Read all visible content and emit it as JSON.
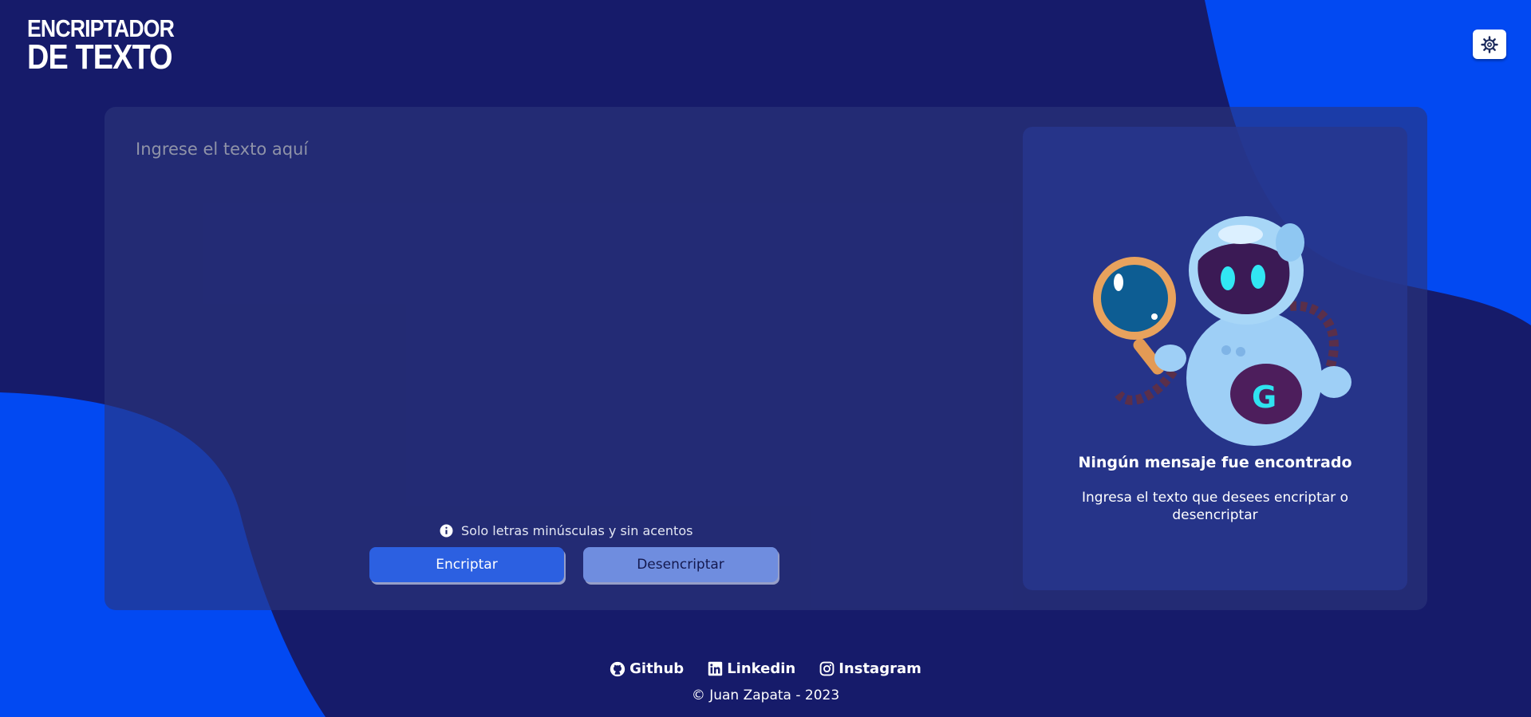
{
  "header": {
    "logo_line1": "ENCRIPTADOR",
    "logo_line2": "DE TEXTO",
    "theme_icon": "gear-icon"
  },
  "editor": {
    "placeholder": "Ingrese el texto aquí",
    "value": "",
    "hint": "Solo letras minúsculas y sin acentos",
    "hint_icon": "info-icon"
  },
  "buttons": {
    "encrypt_label": "Encriptar",
    "decrypt_label": "Desencriptar"
  },
  "result": {
    "illustration": "robot-magnifier-illustration",
    "title": "Ningún mensaje fue encontrado",
    "subtitle": "Ingresa el texto que desees encriptar o desencriptar"
  },
  "footer": {
    "links": [
      {
        "label": "Github",
        "icon": "github-icon"
      },
      {
        "label": "Linkedin",
        "icon": "linkedin-icon"
      },
      {
        "label": "Instagram",
        "icon": "instagram-icon"
      }
    ],
    "copyright": "© Juan Zapata - 2023"
  },
  "colors": {
    "background": "#161b6a",
    "blob": "#0249f2",
    "card": "#2b357b",
    "result_panel": "#27368d",
    "encrypt_button": "#2c60e1",
    "decrypt_button": "#6f8ddf"
  }
}
